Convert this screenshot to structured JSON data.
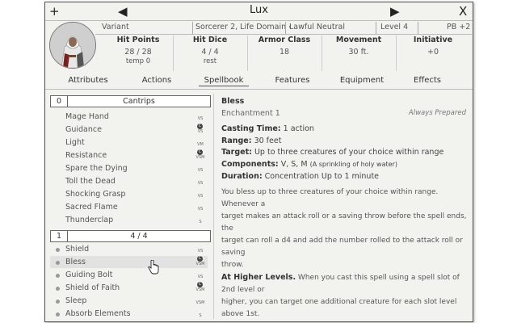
{
  "window": {
    "title": "Lux",
    "add_icon": "+",
    "prev_icon": "◀",
    "next_icon": "▶",
    "close_icon": "X"
  },
  "info": {
    "variant": "Variant",
    "class": "Sorcerer 2, Life Domain ‹",
    "alignment": "Lawful Neutral",
    "level": "Level 4",
    "pb": "PB +2"
  },
  "stats": [
    {
      "header": "Hit Points",
      "value": "28 / 28",
      "sub": "temp  0"
    },
    {
      "header": "Hit Dice",
      "value": "4 / 4",
      "sub": "rest"
    },
    {
      "header": "Armor Class",
      "value": "18",
      "sub": ""
    },
    {
      "header": "Movement",
      "value": "30 ft.",
      "sub": ""
    },
    {
      "header": "Initiative",
      "value": "+0",
      "sub": ""
    }
  ],
  "tabs": [
    "Attributes",
    "Actions",
    "Spellbook",
    "Features",
    "Equipment",
    "Effects"
  ],
  "active_tab": "Spellbook",
  "cantrips": {
    "level": "0",
    "label": "Cantrips",
    "spells": [
      {
        "name": "Mage Hand",
        "comp": "VS",
        "conc": ""
      },
      {
        "name": "Guidance",
        "comp": "VS",
        "conc": "C"
      },
      {
        "name": "Light",
        "comp": "VM",
        "conc": ""
      },
      {
        "name": "Resistance",
        "comp": "VSM",
        "conc": "C"
      },
      {
        "name": "Spare the Dying",
        "comp": "VS",
        "conc": ""
      },
      {
        "name": "Toll the Dead",
        "comp": "VS",
        "conc": ""
      },
      {
        "name": "Shocking Grasp",
        "comp": "VS",
        "conc": ""
      },
      {
        "name": "Sacred Flame",
        "comp": "VS",
        "conc": ""
      },
      {
        "name": "Thunderclap",
        "comp": "S",
        "conc": ""
      }
    ]
  },
  "level1": {
    "level": "1",
    "label": "4 / 4",
    "spells": [
      {
        "name": "Shield",
        "comp": "VS",
        "conc": ""
      },
      {
        "name": "Bless",
        "comp": "VSM",
        "conc": "C"
      },
      {
        "name": "Guiding Bolt",
        "comp": "VS",
        "conc": ""
      },
      {
        "name": "Shield of Faith",
        "comp": "VSM",
        "conc": "C"
      },
      {
        "name": "Sleep",
        "comp": "VSM",
        "conc": ""
      },
      {
        "name": "Absorb Elements",
        "comp": "S",
        "conc": ""
      }
    ]
  },
  "detail": {
    "name": "Bless",
    "school": "Enchantment 1",
    "prepared": "Always Prepared",
    "casting_time_label": "Casting Time:",
    "casting_time": "1 action",
    "range_label": "Range:",
    "range": "30 feet",
    "target_label": "Target:",
    "target": "Up to three creatures of your choice within range",
    "components_label": "Components:",
    "components": "V, S, M",
    "components_note": "(A sprinkling of holy water)",
    "duration_label": "Duration:",
    "duration": "Concentration Up to 1 minute",
    "description": [
      "You bless up to three creatures of your choice within range. Whenever a",
      "target makes an attack roll or a saving throw before the spell ends, the",
      "target can roll a d4 and add the number rolled to the attack roll or saving",
      "throw."
    ],
    "higher_label": "At Higher Levels.",
    "higher": [
      " When you cast this spell using a spell slot of 2nd level or",
      "higher, you can target one additional creature for each slot level above 1st."
    ]
  },
  "colors": {
    "panel": "#f2f2ef",
    "selected_row": "#e2e2e2",
    "text": "#555555"
  }
}
